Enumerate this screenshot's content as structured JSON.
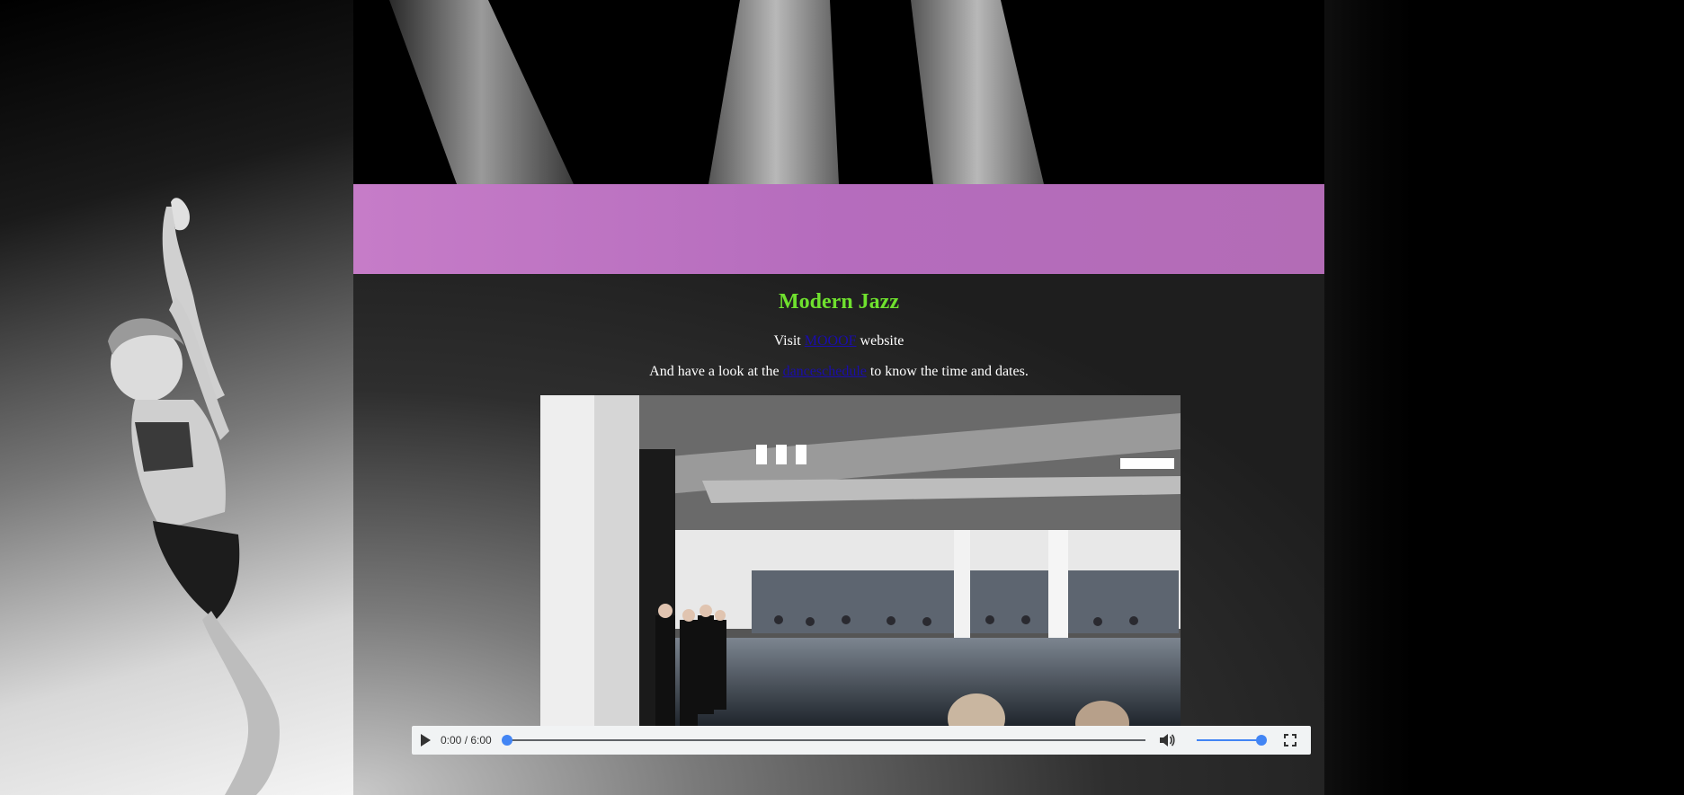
{
  "page": {
    "title": "Modern Jazz",
    "line1": {
      "prefix": "Visit ",
      "link_label": "MOOOF",
      "suffix": " website"
    },
    "line2": {
      "prefix": "And have a look at the ",
      "link_label": "danceschedule",
      "suffix": " to know the time and dates."
    }
  },
  "video": {
    "time_display": "0:00 / 6:00",
    "progress_fraction": 0.0,
    "volume_fraction": 1.0
  },
  "colors": {
    "accent_band": "#b56cbd",
    "title_green": "#6fe12e",
    "link_blue": "#1a0dab",
    "control_blue": "#4285f4"
  },
  "icons": [
    "play-icon",
    "volume-icon",
    "fullscreen-icon"
  ]
}
